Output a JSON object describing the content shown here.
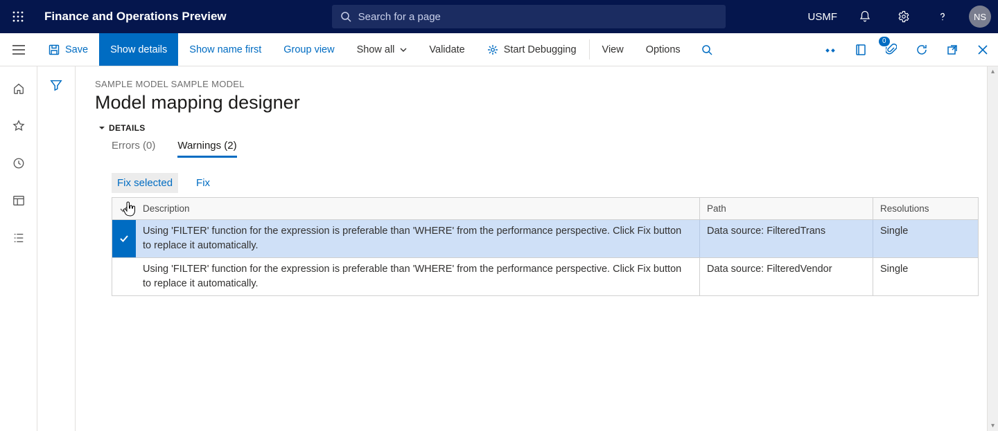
{
  "topbar": {
    "product_name": "Finance and Operations Preview",
    "search_placeholder": "Search for a page",
    "company": "USMF",
    "avatar_initials": "NS"
  },
  "cmdbar": {
    "save": "Save",
    "show_details": "Show details",
    "show_name_first": "Show name first",
    "group_view": "Group view",
    "show_all": "Show all",
    "validate": "Validate",
    "start_debugging": "Start Debugging",
    "view": "View",
    "options": "Options",
    "attachments_badge": "0"
  },
  "page": {
    "breadcrumb": "SAMPLE MODEL SAMPLE MODEL",
    "title": "Model mapping designer",
    "section": "DETAILS"
  },
  "tabs": {
    "errors": "Errors (0)",
    "warnings": "Warnings (2)"
  },
  "actions": {
    "fix_selected": "Fix selected",
    "fix": "Fix"
  },
  "grid": {
    "headers": {
      "description": "Description",
      "path": "Path",
      "resolutions": "Resolutions"
    },
    "rows": [
      {
        "selected": true,
        "description": "Using 'FILTER' function for the expression is preferable than 'WHERE' from the performance perspective. Click Fix button to replace it automatically.",
        "path": "Data source: FilteredTrans",
        "resolutions": "Single"
      },
      {
        "selected": false,
        "description": "Using 'FILTER' function for the expression is preferable than 'WHERE' from the performance perspective. Click Fix button to replace it automatically.",
        "path": "Data source: FilteredVendor",
        "resolutions": "Single"
      }
    ]
  }
}
